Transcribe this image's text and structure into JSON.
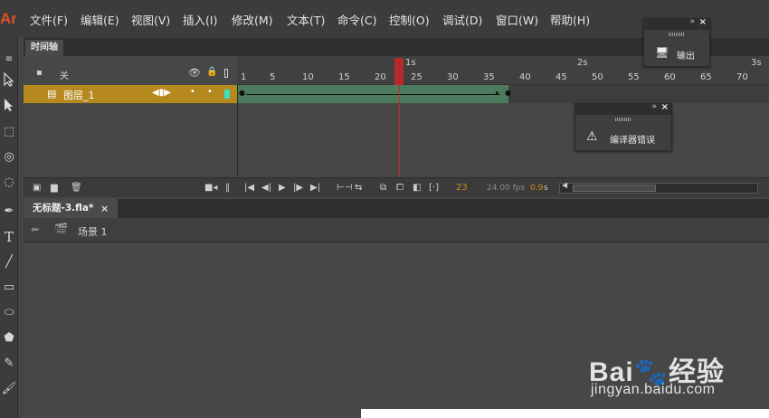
{
  "app": {
    "logo": "An"
  },
  "menu": [
    "文件(F)",
    "编辑(E)",
    "视图(V)",
    "插入(I)",
    "修改(M)",
    "文本(T)",
    "命令(C)",
    "控制(O)",
    "调试(D)",
    "窗口(W)",
    "帮助(H)"
  ],
  "timeline": {
    "tab_label": "时间轴",
    "layer_header_label": "关",
    "layer_name": "图层_1",
    "ruler_numbers": [
      "1",
      "5",
      "10",
      "15",
      "20",
      "25",
      "30",
      "35",
      "40",
      "45",
      "50",
      "55",
      "60",
      "65",
      "70"
    ],
    "ruler_seconds": [
      "1s",
      "2s",
      "3s"
    ],
    "current_frame": "23",
    "fps": "24.00 fps",
    "elapsed": "0.9",
    "elapsed_unit": "s",
    "playhead_frame": 23
  },
  "panels": {
    "output": {
      "label": "输出"
    },
    "compiler_errors": {
      "label": "编译器错误"
    }
  },
  "document": {
    "tab_title": "无标题-3.fla*",
    "close_glyph": "×",
    "scene_label": "场景 1"
  },
  "watermark": {
    "brand": "Bai🐾经验",
    "url": "jingyan.baidu.com"
  },
  "colors": {
    "layer_selected": "#b5891d",
    "tween_span": "#4b7a5c",
    "playhead": "#b72a2a",
    "fps_highlight": "#d08a17"
  }
}
